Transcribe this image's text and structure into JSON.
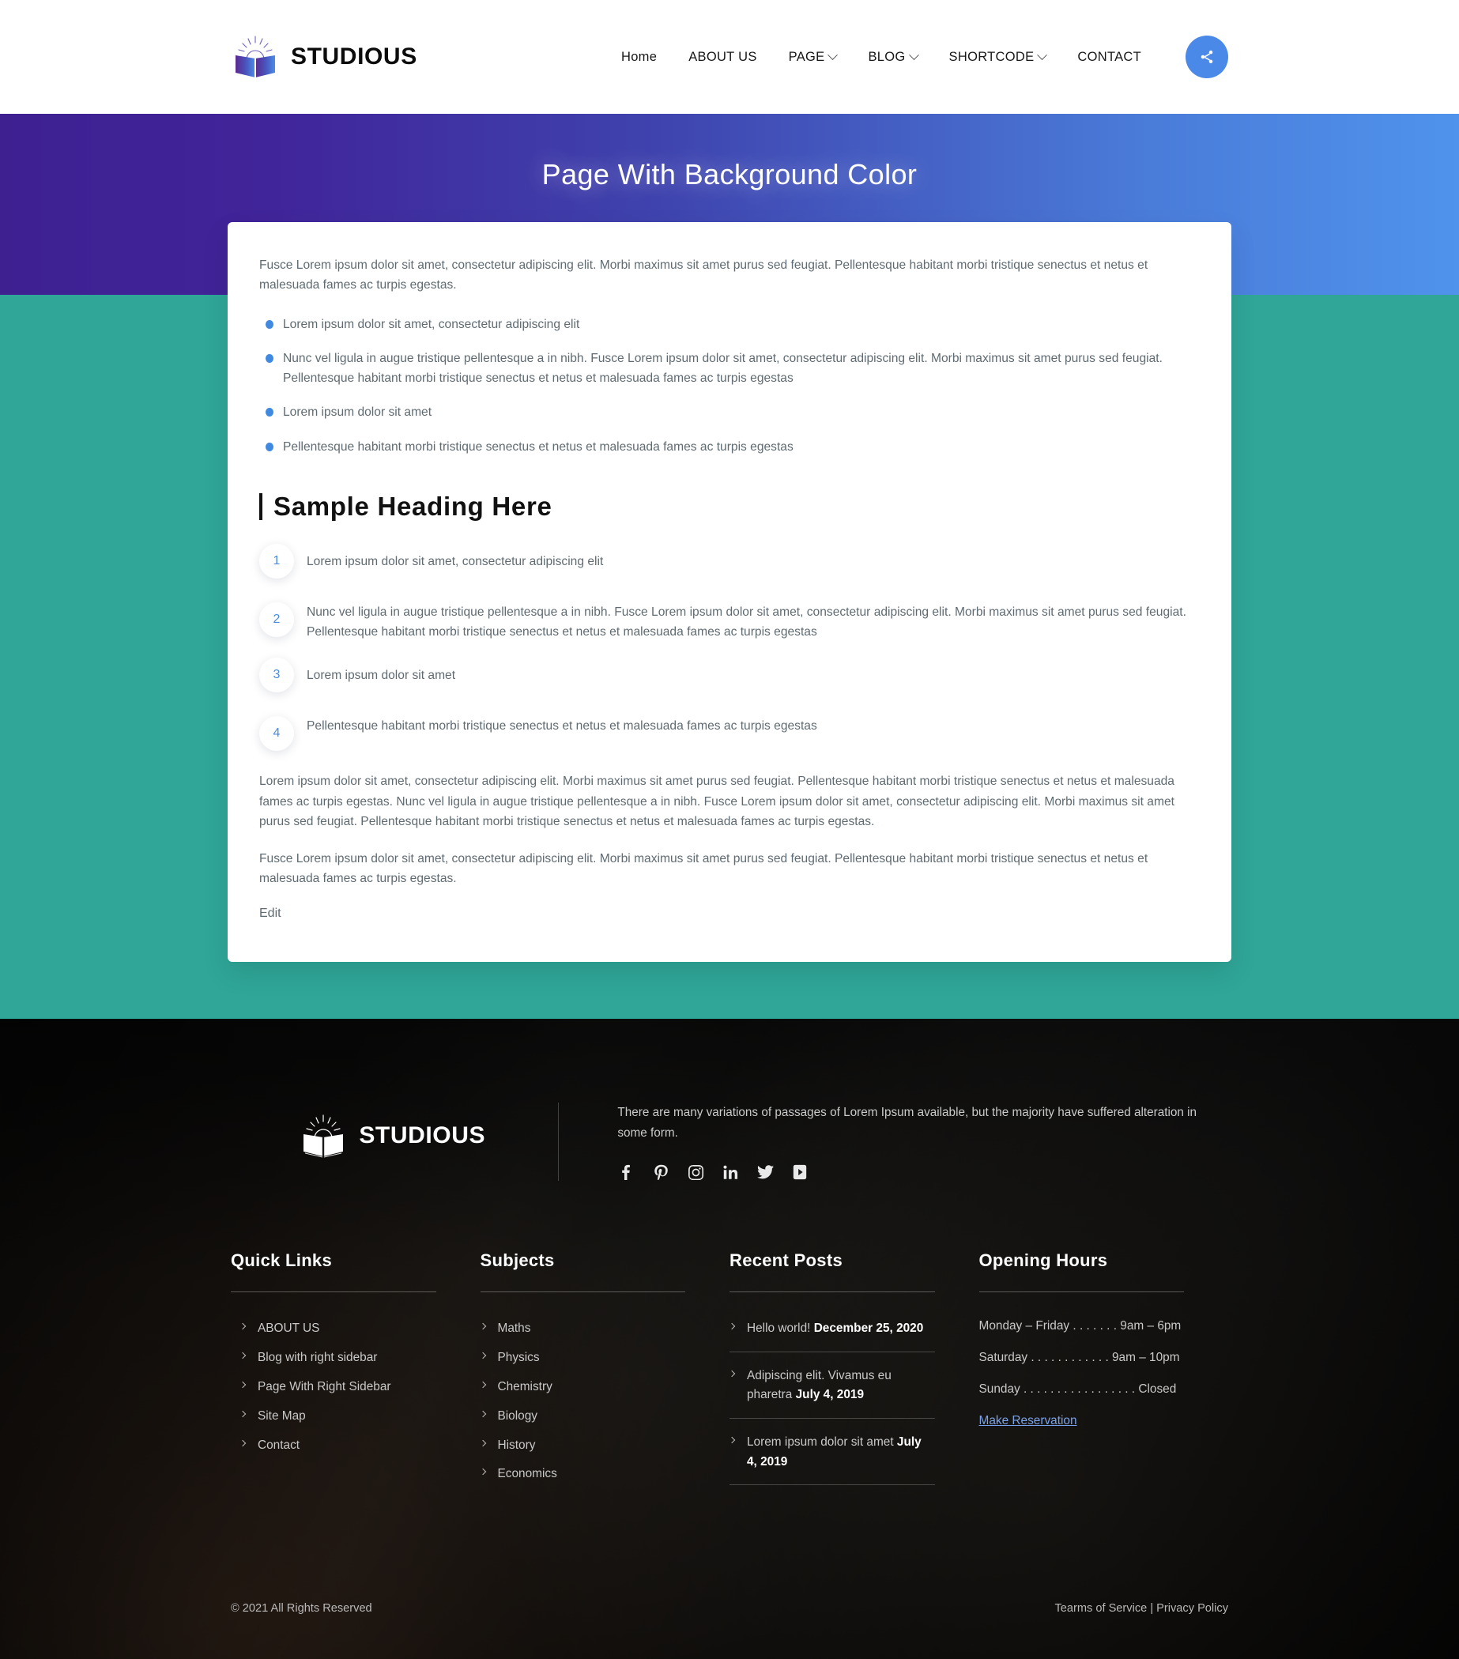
{
  "brand": {
    "name": "STUDIOUS"
  },
  "nav": {
    "items": [
      {
        "label": "Home",
        "caret": false
      },
      {
        "label": "ABOUT US",
        "caret": false
      },
      {
        "label": "PAGE",
        "caret": true
      },
      {
        "label": "BLOG",
        "caret": true
      },
      {
        "label": "SHORTCODE",
        "caret": true
      },
      {
        "label": "CONTACT",
        "caret": false
      }
    ],
    "share_icon": "share-icon"
  },
  "hero": {
    "title": "Page With Background Color"
  },
  "content": {
    "intro": "Fusce Lorem ipsum dolor sit amet, consectetur adipiscing elit. Morbi maximus sit amet purus sed feugiat. Pellentesque habitant morbi tristique senectus et netus et malesuada fames ac turpis egestas.",
    "bullets": [
      "Lorem ipsum dolor sit amet, consectetur adipiscing elit",
      "Nunc vel ligula in augue tristique pellentesque a in nibh. Fusce Lorem ipsum dolor sit amet, consectetur adipiscing elit. Morbi maximus sit amet purus sed feugiat. Pellentesque habitant morbi tristique senectus et netus et malesuada fames ac turpis egestas",
      "Lorem ipsum dolor sit amet",
      "Pellentesque habitant morbi tristique senectus et netus et malesuada fames ac turpis egestas"
    ],
    "heading": "Sample Heading Here",
    "numbered": [
      {
        "num": "1",
        "text": "Lorem ipsum dolor sit amet, consectetur adipiscing elit"
      },
      {
        "num": "2",
        "text": "Nunc vel ligula in augue tristique pellentesque a in nibh. Fusce Lorem ipsum dolor sit amet, consectetur adipiscing elit. Morbi maximus sit amet purus sed feugiat. Pellentesque habitant morbi tristique senectus et netus et malesuada fames ac turpis egestas"
      },
      {
        "num": "3",
        "text": "Lorem ipsum dolor sit amet"
      },
      {
        "num": "4",
        "text": "Pellentesque habitant morbi tristique senectus et netus et malesuada fames ac turpis egestas"
      }
    ],
    "para_a": "Lorem ipsum dolor sit amet, consectetur adipiscing elit. Morbi maximus sit amet purus sed feugiat. Pellentesque habitant morbi tristique senectus et netus et malesuada fames ac turpis egestas. Nunc vel ligula in augue tristique pellentesque a in nibh. Fusce Lorem ipsum dolor sit amet, consectetur adipiscing elit. Morbi maximus sit amet purus sed feugiat. Pellentesque habitant morbi tristique senectus et netus et malesuada fames ac turpis egestas.",
    "para_b": "Fusce Lorem ipsum dolor sit amet, consectetur adipiscing elit. Morbi maximus sit amet purus sed feugiat. Pellentesque habitant morbi tristique senectus et netus et malesuada fames ac turpis egestas.",
    "edit_label": "Edit"
  },
  "footer": {
    "about": "There are many variations of passages of Lorem Ipsum available, but the majority have suffered alteration in some form.",
    "socials": [
      {
        "name": "facebook-icon"
      },
      {
        "name": "pinterest-icon"
      },
      {
        "name": "instagram-icon"
      },
      {
        "name": "linkedin-icon"
      },
      {
        "name": "twitter-icon"
      },
      {
        "name": "youtube-icon"
      }
    ],
    "quick_links": {
      "title": "Quick Links",
      "items": [
        "ABOUT US",
        "Blog with right sidebar",
        "Page With Right Sidebar",
        "Site Map",
        "Contact"
      ]
    },
    "subjects": {
      "title": "Subjects",
      "items": [
        "Maths",
        "Physics",
        "Chemistry",
        "Biology",
        "History",
        "Economics"
      ]
    },
    "recent_posts": {
      "title": "Recent Posts",
      "items": [
        {
          "text": "Hello world!",
          "date": "December 25, 2020"
        },
        {
          "text": "Adipiscing elit. Vivamus eu pharetra",
          "date": "July 4, 2019"
        },
        {
          "text": "Lorem ipsum dolor sit amet",
          "date": "July 4, 2019"
        }
      ]
    },
    "opening_hours": {
      "title": "Opening Hours",
      "rows": [
        "Monday – Friday . . . . . . . 9am – 6pm",
        "Saturday . . . . . . . . . . . . 9am – 10pm",
        "Sunday . . . . . . . . . . . . . . . . . Closed"
      ],
      "reserve_label": "Make Reservation"
    },
    "copyright": "© 2021 All Rights Reserved",
    "terms_label": "Tearms of Service",
    "separator": "|",
    "privacy_label": "Privacy Policy"
  },
  "colors": {
    "accent_blue": "#4a89e8",
    "teal": "#2fa698",
    "hero_from": "#3e2091",
    "hero_to": "#4f93ec"
  }
}
